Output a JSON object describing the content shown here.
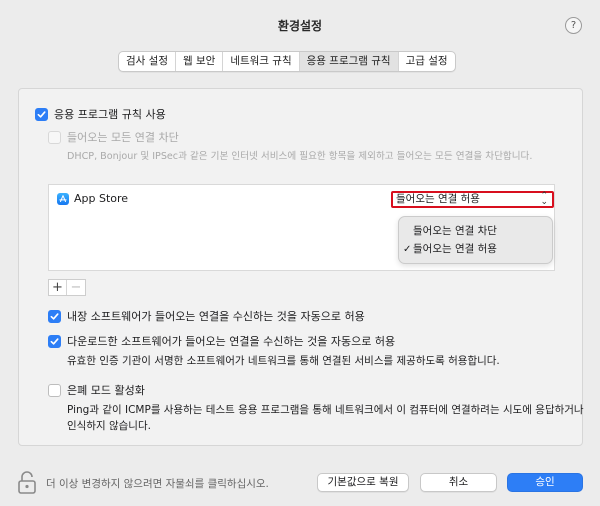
{
  "window": {
    "title": "환경설정",
    "help_label": "?"
  },
  "tabs": [
    {
      "label": "검사 설정"
    },
    {
      "label": "웹 보안"
    },
    {
      "label": "네트워크 규칙"
    },
    {
      "label": "응용 프로그램 규칙",
      "selected": true
    },
    {
      "label": "고급 설정"
    }
  ],
  "app_rules": {
    "enable_label": "응용 프로그램 규칙 사용",
    "enable_checked": true,
    "block_incoming_label": "들어오는 모든 연결 차단",
    "block_incoming_checked": false,
    "block_incoming_desc": "DHCP, Bonjour 및 IPSec과 같은 기본 인터넷 서비스에 필요한 항목을 제외하고 들어오는 모든 연결을 차단합니다.",
    "apps": [
      {
        "name": "App Store",
        "rule": "들어오는 연결 허용",
        "icon": "app-store-icon"
      }
    ],
    "dropdown_options": [
      {
        "label": "들어오는 연결 차단",
        "checked": false
      },
      {
        "label": "들어오는 연결 허용",
        "checked": true
      }
    ],
    "add_label": "+",
    "remove_label": "−",
    "builtin_label": "내장 소프트웨어가 들어오는 연결을 수신하는 것을 자동으로 허용",
    "builtin_checked": true,
    "downloaded_label": "다운로드한 소프트웨어가 들어오는 연결을 수신하는 것을 자동으로 허용",
    "downloaded_checked": true,
    "downloaded_desc": "유효한 인증 기관이 서명한 소프트웨어가 네트워크를 통해 연결된 서비스를 제공하도록 허용합니다.",
    "stealth_label": "은폐 모드 활성화",
    "stealth_checked": false,
    "stealth_desc_line1": "Ping과 같이 ICMP를 사용하는 테스트 응용 프로그램을 통해 네트워크에서 이 컴퓨터에 연결하려는 시도에 응답하거나",
    "stealth_desc_line2": "인식하지 않습니다."
  },
  "footer": {
    "lock_text": "더 이상 변경하지 않으려면 자물쇠를 클릭하십시오.",
    "restore_defaults_label": "기본값으로 복원",
    "cancel_label": "취소",
    "ok_label": "승인"
  },
  "colors": {
    "accent": "#2d7ef6",
    "highlight_border": "#d80f1e"
  }
}
